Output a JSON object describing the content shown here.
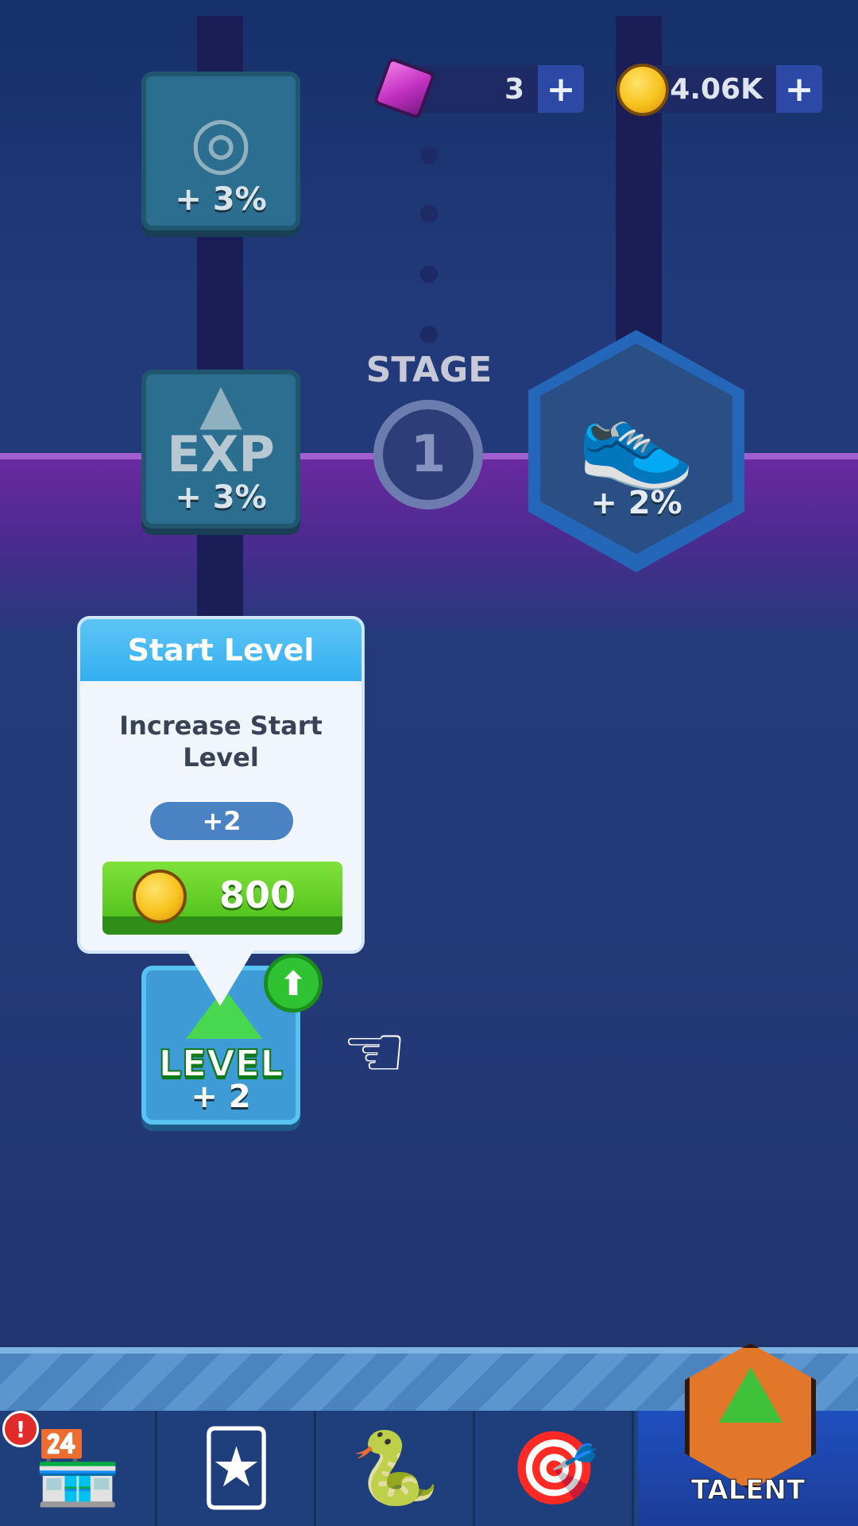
{
  "currency": {
    "gems": "3",
    "coins": "4.06K",
    "add_symbol": "+"
  },
  "stage": {
    "label": "STAGE",
    "number": "1"
  },
  "talents": {
    "coin_bonus_pct": "+ 3%",
    "exp_word": "EXP",
    "exp_bonus_pct": "+ 3%",
    "speed_bonus_pct": "+ 2%",
    "level_word": "LEVEL",
    "level_bonus": "+ 2"
  },
  "popup": {
    "title": "Start Level",
    "description": "Increase Start Level",
    "increment": "+2",
    "cost": "800"
  },
  "nav": {
    "active_label": "TALENT",
    "items": [
      "shop",
      "cards",
      "snake",
      "target",
      "talent"
    ]
  },
  "colors": {
    "background": "#233a7a",
    "accent_green": "#56c51f",
    "popup_header": "#34aef0",
    "stage_band": "#6a2aa0"
  }
}
